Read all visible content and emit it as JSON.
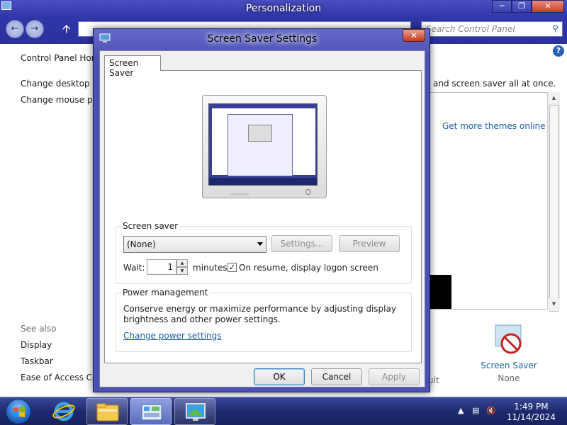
{
  "background_window": {
    "title": "Personalization",
    "search_placeholder": "Search Control Panel",
    "left_links": [
      "Control Panel Home",
      "Change desktop icons",
      "Change mouse pointers"
    ],
    "see_also_label": "See also",
    "see_also_links": [
      "Display",
      "Taskbar",
      "Ease of Access Center"
    ],
    "description": "and screen saver all at once.",
    "get_themes_link": "Get more themes online",
    "screen_saver_tile": {
      "label": "Screen Saver",
      "value": "None"
    },
    "partial_text": "ult"
  },
  "dialog": {
    "title": "Screen Saver Settings",
    "tab": "Screen Saver",
    "screen_saver_group": "Screen saver",
    "selected_saver": "(None)",
    "settings_button": "Settings...",
    "preview_button": "Preview",
    "wait_label": "Wait:",
    "wait_value": "1",
    "minutes_label": "minutes",
    "on_resume_label": "On resume, display logon screen",
    "on_resume_checked": true,
    "power_group": "Power management",
    "power_text_line1": "Conserve energy or maximize performance by adjusting display",
    "power_text_line2": "brightness and other power settings.",
    "power_link": "Change power settings",
    "ok": "OK",
    "cancel": "Cancel",
    "apply": "Apply"
  },
  "taskbar": {
    "time": "1:49 PM",
    "date": "11/14/2024",
    "apps": [
      "internet-explorer",
      "file-explorer",
      "control-panel",
      "screen-saver-settings"
    ]
  },
  "colors": {
    "accent": "#2f36a8",
    "link": "#1a5fa8"
  }
}
